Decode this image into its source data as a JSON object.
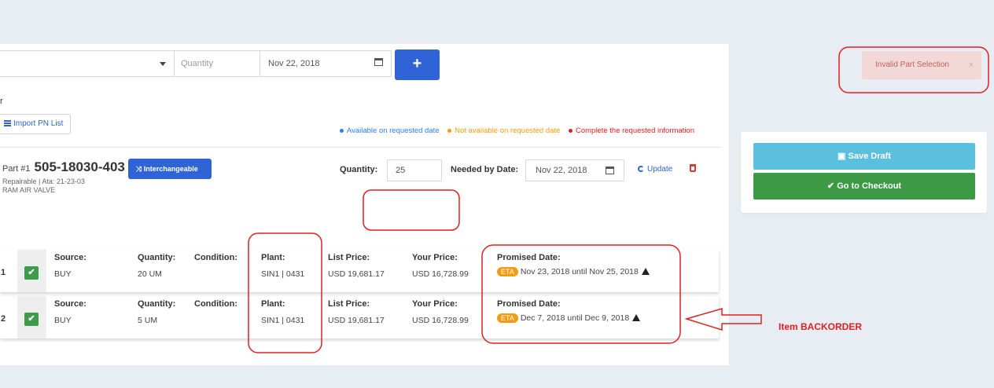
{
  "form": {
    "quantity_placeholder": "Quantity",
    "date_value": "Nov 22, 2018",
    "add_label": "+",
    "or_label": "r",
    "import_label": "Import PN List"
  },
  "legend": [
    {
      "label": "Available on requested date",
      "color": "#2f80ed"
    },
    {
      "label": "Not available on requested date",
      "color": "#f39c12"
    },
    {
      "label": "Complete the requested information",
      "color": "#e02020"
    }
  ],
  "part": {
    "prefix": "Part #1",
    "number": "505-18030-403",
    "interchangeable_label": "Interchangeable",
    "meta_line1": "Repairable | Ata: 21-23-03",
    "meta_line2": "RAM AIR VALVE",
    "quantity_label": "Quantity:",
    "quantity_value": "25",
    "needed_label": "Needed by Date:",
    "needed_value": "Nov 22, 2018",
    "update_label": "Update"
  },
  "columns": {
    "source": "Source:",
    "quantity": "Quantity:",
    "condition": "Condition:",
    "plant": "Plant:",
    "list_price": "List Price:",
    "your_price": "Your Price:",
    "promised": "Promised Date:"
  },
  "rows": [
    {
      "num": "1",
      "source": "BUY",
      "quantity": "20 UM",
      "condition": "",
      "plant": "SIN1 | 0431",
      "list_price": "USD 19,681.17",
      "your_price": "USD 16,728.99",
      "eta": "ETA",
      "promised": "Nov 23, 2018 until Nov 25, 2018"
    },
    {
      "num": "2",
      "source": "BUY",
      "quantity": "5 UM",
      "condition": "",
      "plant": "SIN1 | 0431",
      "list_price": "USD 19,681.17",
      "your_price": "USD 16,728.99",
      "eta": "ETA",
      "promised": "Dec 7, 2018 until Dec 9, 2018"
    }
  ],
  "sidebar": {
    "toast_text": "Invalid Part Selection",
    "toast_close": "×",
    "save_label": "Save Draft",
    "checkout_label": "Go to Checkout"
  },
  "annotation": {
    "backorder_label": "Item BACKORDER",
    "color": "#e02020"
  }
}
